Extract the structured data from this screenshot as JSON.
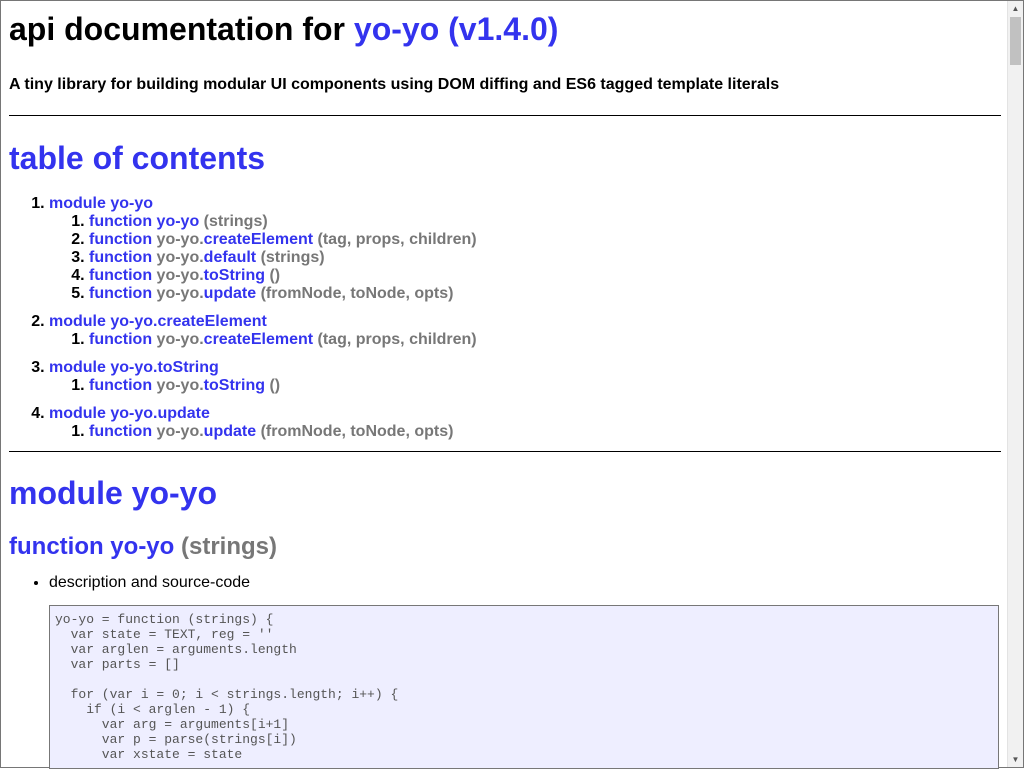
{
  "header": {
    "title_prefix": "api documentation for",
    "title_link": "yo-yo (v1.4.0)",
    "description": "A tiny library for building modular UI components using DOM diffing and ES6 tagged template literals"
  },
  "toc": {
    "heading": "table of contents",
    "modules": [
      {
        "label": "module yo-yo",
        "functions": [
          {
            "kw": "function",
            "prefix": "",
            "name": "yo-yo",
            "args": "(strings)"
          },
          {
            "kw": "function",
            "prefix": "yo-yo.",
            "name": "createElement",
            "args": "(tag, props, children)"
          },
          {
            "kw": "function",
            "prefix": "yo-yo.",
            "name": "default",
            "args": "(strings)"
          },
          {
            "kw": "function",
            "prefix": "yo-yo.",
            "name": "toString",
            "args": "()"
          },
          {
            "kw": "function",
            "prefix": "yo-yo.",
            "name": "update",
            "args": "(fromNode, toNode, opts)"
          }
        ]
      },
      {
        "label": "module yo-yo.createElement",
        "functions": [
          {
            "kw": "function",
            "prefix": "yo-yo.",
            "name": "createElement",
            "args": "(tag, props, children)"
          }
        ]
      },
      {
        "label": "module yo-yo.toString",
        "functions": [
          {
            "kw": "function",
            "prefix": "yo-yo.",
            "name": "toString",
            "args": "()"
          }
        ]
      },
      {
        "label": "module yo-yo.update",
        "functions": [
          {
            "kw": "function",
            "prefix": "yo-yo.",
            "name": "update",
            "args": "(fromNode, toNode, opts)"
          }
        ]
      }
    ]
  },
  "module_section": {
    "heading": "module yo-yo",
    "function_heading": {
      "kw_name": "function yo-yo",
      "args": "(strings)"
    },
    "bullet": "description and source-code",
    "code": "yo-yo = function (strings) {\n  var state = TEXT, reg = ''\n  var arglen = arguments.length\n  var parts = []\n\n  for (var i = 0; i < strings.length; i++) {\n    if (i < arglen - 1) {\n      var arg = arguments[i+1]\n      var p = parse(strings[i])\n      var xstate = state"
  }
}
